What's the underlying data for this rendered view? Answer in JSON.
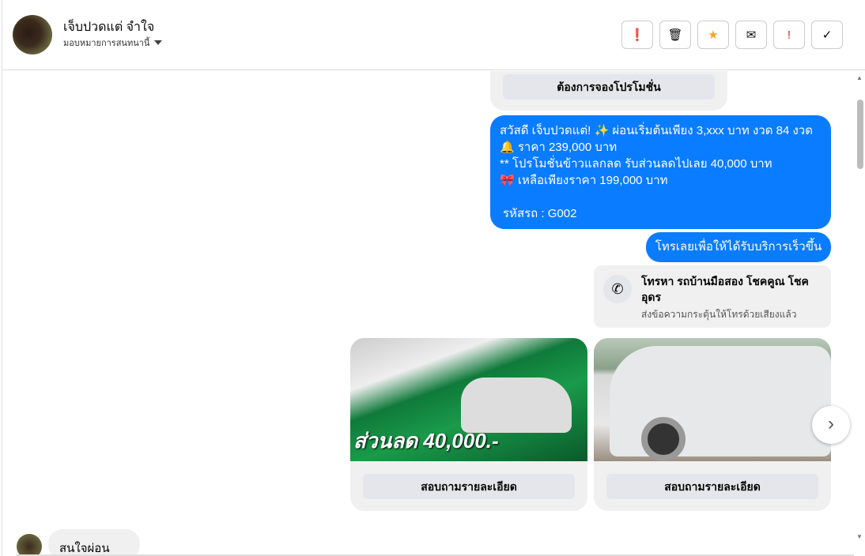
{
  "header": {
    "name": "เจ็บปวดแต่ จำใจ",
    "assign": "มอบหมายการสนทนานี้"
  },
  "actions": [
    {
      "name": "report-icon",
      "glyph": "❗"
    },
    {
      "name": "trash-icon",
      "glyph": "🗑"
    },
    {
      "name": "star-icon",
      "glyph": "★"
    },
    {
      "name": "mail-icon",
      "glyph": "✉"
    },
    {
      "name": "important-icon",
      "glyph": "!"
    },
    {
      "name": "check-icon",
      "glyph": "✓"
    }
  ],
  "messages": {
    "promo_button": "ต้องการจองโปรโมชั่น",
    "promo_lines": [
      "สวัสดี เจ็บปวดแต่! ✨  ผ่อนเริ่มต้นเพียง 3,xxx บาท งวด 84 งวด",
      "🔔 ราคา 239,000 บาท",
      "** โปรโมชั่นข้าวแลกลด รับส่วนลดไปเลย 40,000 บาท",
      "🎀  เหลือเพียงราคา 199,000 บาท",
      "",
      "รหัสรถ : G002"
    ],
    "call_prompt": "โทรเลยเพื่อให้ได้รับบริการเร็วขึ้น",
    "call_title": "โทรหา รถบ้านมือสอง โชคคูณ โชคอุดร",
    "call_sub": "ส่งข้อความกระตุ้นให้โทรด้วยเสียงแล้ว",
    "cards": [
      {
        "price_text": "ส่วนลด 40,000.-",
        "button": "สอบถามรายละเอียด"
      },
      {
        "button": "สอบถามรายละเอียด"
      }
    ],
    "incoming": "สนใจผ่อนครับ"
  }
}
